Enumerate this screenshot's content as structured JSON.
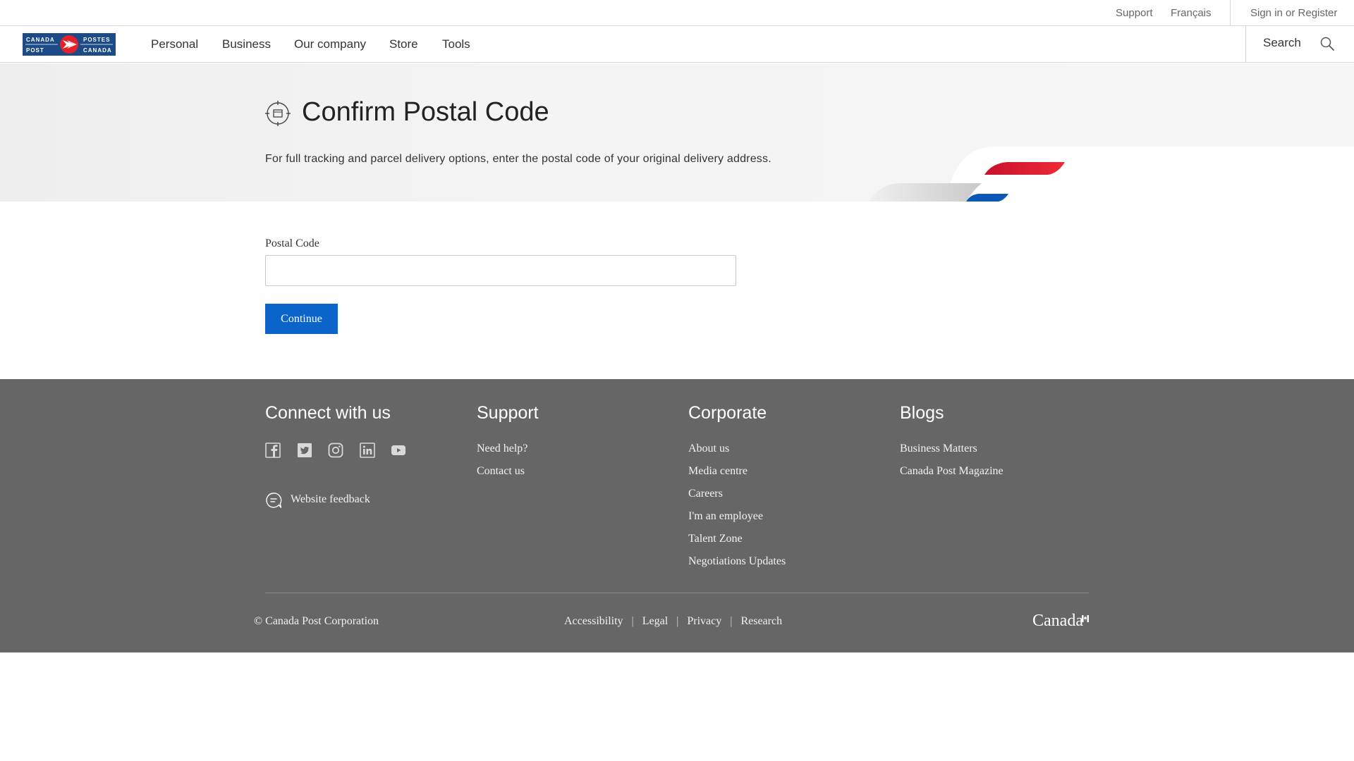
{
  "utility": {
    "support": "Support",
    "language": "Français",
    "sign_in": "Sign in or Register"
  },
  "nav": {
    "logo_text": [
      "CANADA",
      "POSTES",
      "POST",
      "CANADA"
    ],
    "items": [
      "Personal",
      "Business",
      "Our company",
      "Store",
      "Tools"
    ],
    "search_label": "Search"
  },
  "hero": {
    "title": "Confirm Postal Code",
    "description": "For full tracking and parcel delivery options, enter the postal code of your original delivery address."
  },
  "form": {
    "label": "Postal Code",
    "value": "",
    "placeholder": "",
    "submit": "Continue"
  },
  "footer": {
    "connect": {
      "heading": "Connect with us",
      "social": [
        "facebook-icon",
        "twitter-icon",
        "instagram-icon",
        "linkedin-icon",
        "youtube-icon"
      ],
      "feedback": "Website feedback"
    },
    "support": {
      "heading": "Support",
      "links": [
        "Need help?",
        "Contact us"
      ]
    },
    "corporate": {
      "heading": "Corporate",
      "links": [
        "About us",
        "Media centre",
        "Careers",
        "I'm an employee",
        "Talent Zone",
        "Negotiations Updates"
      ]
    },
    "blogs": {
      "heading": "Blogs",
      "links": [
        "Business Matters",
        "Canada Post Magazine"
      ]
    },
    "copyright": "© Canada Post Corporation",
    "legal": [
      "Accessibility",
      "Legal",
      "Privacy",
      "Research"
    ],
    "wordmark": "Canada"
  },
  "colors": {
    "brand_blue": "#1d4b87",
    "brand_red": "#e1232b",
    "button_blue": "#0b64c9",
    "footer_bg": "#666666"
  }
}
